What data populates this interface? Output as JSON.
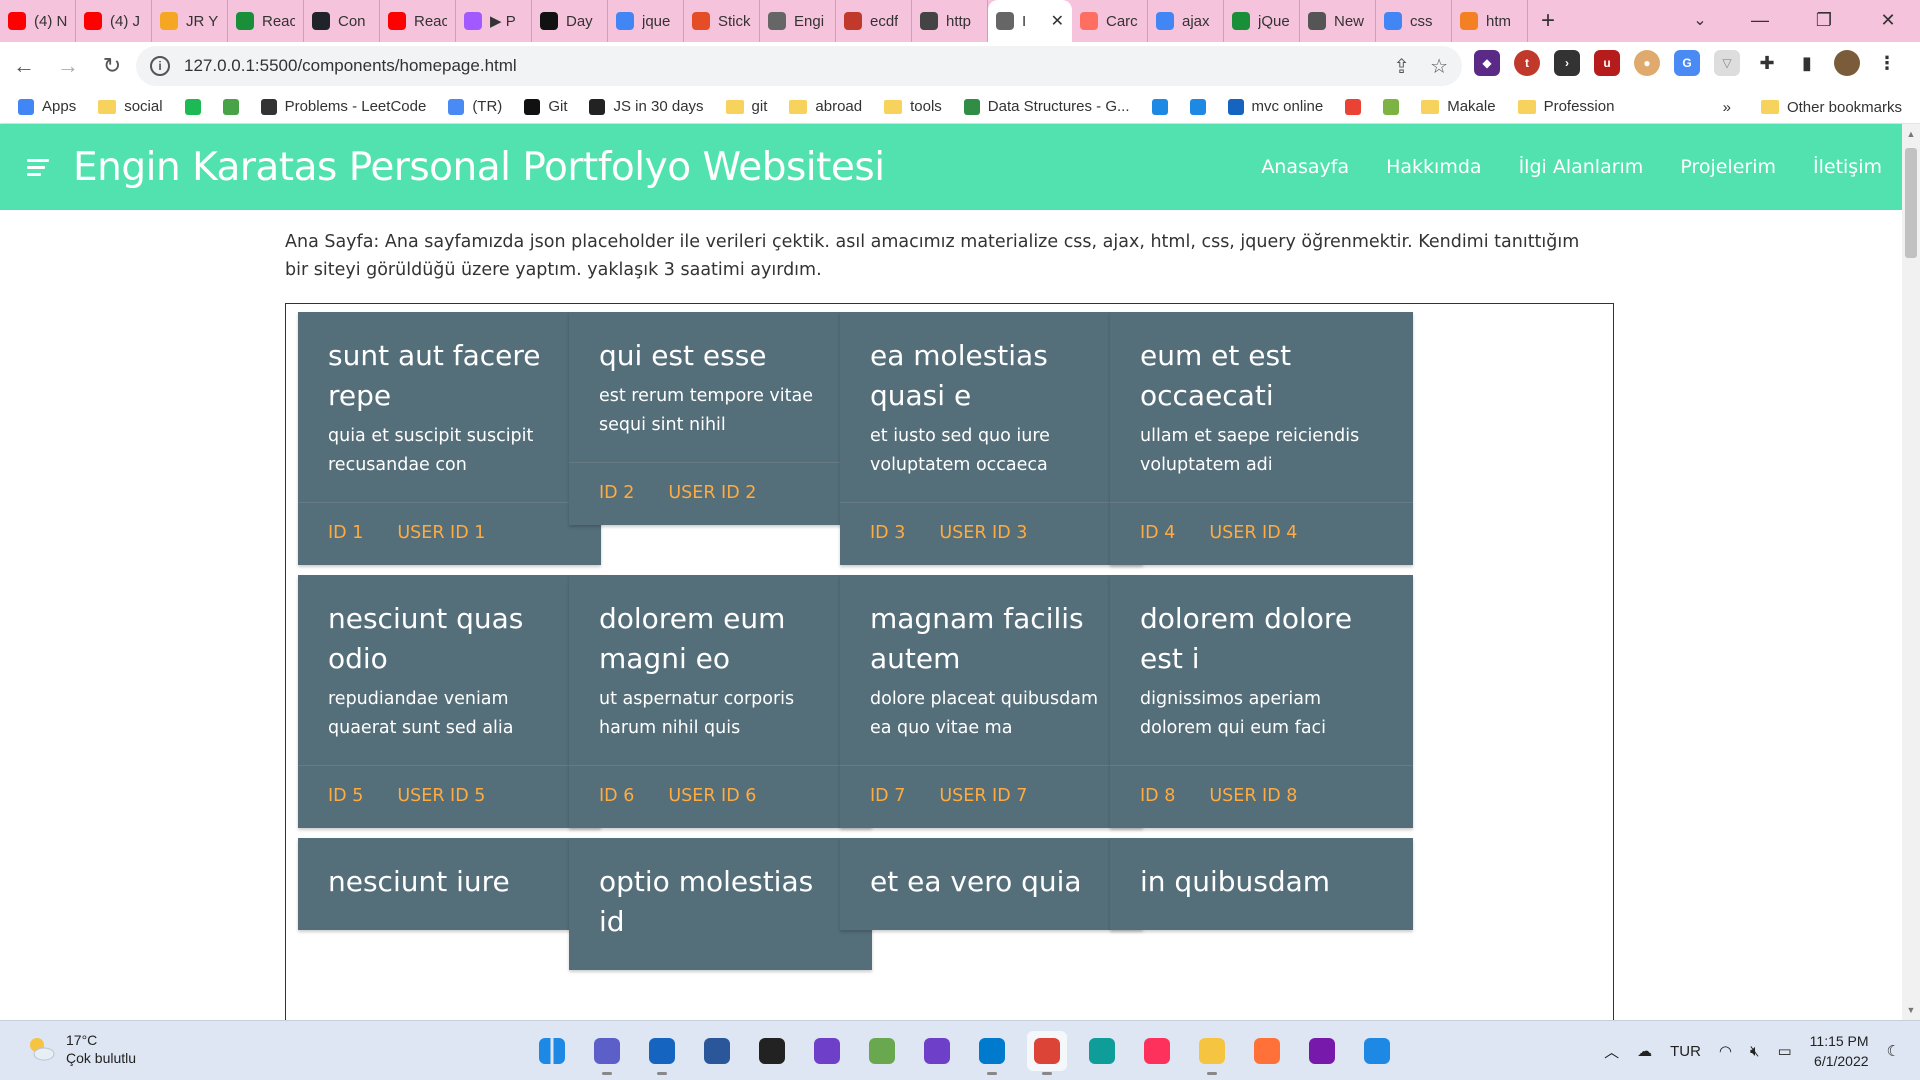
{
  "browser": {
    "tabs": [
      {
        "title": "(4) N",
        "icon": "youtube-icon",
        "color": "#ff0000"
      },
      {
        "title": "(4) J",
        "icon": "youtube-icon",
        "color": "#ff0000"
      },
      {
        "title": "JR Y",
        "icon": "k-icon",
        "color": "#f5a623"
      },
      {
        "title": "Reac",
        "icon": "w-icon",
        "color": "#1a8f3a"
      },
      {
        "title": "Con",
        "icon": "react-icon",
        "color": "#20232a"
      },
      {
        "title": "Reac",
        "icon": "youtube-icon",
        "color": "#ff0000"
      },
      {
        "title": "▶ P",
        "icon": "figma-icon",
        "color": "#a259ff"
      },
      {
        "title": "Day",
        "icon": "hashnode-icon",
        "color": "#111111"
      },
      {
        "title": "jque",
        "icon": "google-icon",
        "color": "#4285f4"
      },
      {
        "title": "Stick",
        "icon": "star-icon",
        "color": "#e44d26"
      },
      {
        "title": "Engi",
        "icon": "globe-icon",
        "color": "#666666"
      },
      {
        "title": "ecdf",
        "icon": "hf-icon",
        "color": "#c0392b"
      },
      {
        "title": "http",
        "icon": "terminal-icon",
        "color": "#444444"
      },
      {
        "title": "I",
        "icon": "globe-icon",
        "color": "#666666",
        "active": true
      },
      {
        "title": "Carc",
        "icon": "m-icon",
        "color": "#ff6f61"
      },
      {
        "title": "ajax",
        "icon": "google-icon",
        "color": "#4285f4"
      },
      {
        "title": "jQue",
        "icon": "w-icon",
        "color": "#1a8f3a"
      },
      {
        "title": "New",
        "icon": "chrome-icon",
        "color": "#555555"
      },
      {
        "title": "css",
        "icon": "google-icon",
        "color": "#4285f4"
      },
      {
        "title": "htm",
        "icon": "stackoverflow-icon",
        "color": "#f48024"
      }
    ],
    "new_tab": "+",
    "url": "127.0.0.1:5500/components/homepage.html",
    "bookmarks": [
      {
        "label": "Apps",
        "icon": "apps-grid-icon"
      },
      {
        "label": "social",
        "icon": "folder-icon"
      },
      {
        "label": "",
        "icon": "spotify-icon"
      },
      {
        "label": "",
        "icon": "leaf-icon"
      },
      {
        "label": "Problems - LeetCode",
        "icon": "leetcode-icon"
      },
      {
        "label": "(TR)",
        "icon": "translate-icon"
      },
      {
        "label": "Git",
        "icon": "github-icon"
      },
      {
        "label": "JS in 30 days",
        "icon": "js30-icon"
      },
      {
        "label": "git",
        "icon": "folder-icon"
      },
      {
        "label": "abroad",
        "icon": "folder-icon"
      },
      {
        "label": "tools",
        "icon": "folder-icon"
      },
      {
        "label": "Data Structures - G...",
        "icon": "gfg-icon"
      },
      {
        "label": "",
        "icon": "x-icon"
      },
      {
        "label": "",
        "icon": "html5-icon"
      },
      {
        "label": "mvc online",
        "icon": "mvc-icon"
      },
      {
        "label": "",
        "icon": "gmail-icon"
      },
      {
        "label": "",
        "icon": "plant-icon"
      },
      {
        "label": "Makale",
        "icon": "folder-icon"
      },
      {
        "label": "Profession",
        "icon": "folder-icon"
      }
    ],
    "bookmarks_more": "»",
    "other_bookmarks": "Other bookmarks"
  },
  "site": {
    "brand": "Engin Karatas Personal Portfolyo Websitesi",
    "nav": [
      "Anasayfa",
      "Hakkımda",
      "İlgi Alanlarım",
      "Projelerim",
      "İletişim"
    ],
    "intro": "Ana Sayfa: Ana sayfamızda json placeholder ile verileri çektik. asıl amacımız materialize css, ajax, html, css, jquery öğrenmektir. Kendimi tanıttığım bir siteyi görüldüğü üzere yaptım. yaklaşık 3 saatimi ayırdım.",
    "cards": [
      {
        "title": "sunt aut facere repe",
        "body": "quia et suscipit suscipit recusandae con",
        "id": "ID 1",
        "user": "USER ID 1"
      },
      {
        "title": "qui est esse",
        "body": "est rerum tempore vitae sequi sint nihil",
        "id": "ID 2",
        "user": "USER ID 2"
      },
      {
        "title": "ea molestias quasi e",
        "body": "et iusto sed quo iure voluptatem occaeca",
        "id": "ID 3",
        "user": "USER ID 3"
      },
      {
        "title": "eum et est occaecati",
        "body": "ullam et saepe reiciendis voluptatem adi",
        "id": "ID 4",
        "user": "USER ID 4"
      },
      {
        "title": "nesciunt quas odio",
        "body": "repudiandae veniam quaerat sunt sed alia",
        "id": "ID 5",
        "user": "USER ID 5"
      },
      {
        "title": "dolorem eum magni eo",
        "body": "ut aspernatur corporis harum nihil quis",
        "id": "ID 6",
        "user": "USER ID 6"
      },
      {
        "title": "magnam facilis autem",
        "body": "dolore placeat quibusdam ea quo vitae ma",
        "id": "ID 7",
        "user": "USER ID 7"
      },
      {
        "title": "dolorem dolore est i",
        "body": "dignissimos aperiam dolorem qui eum faci",
        "id": "ID 8",
        "user": "USER ID 8"
      },
      {
        "title": "nesciunt iure",
        "body": "",
        "id": "",
        "user": ""
      },
      {
        "title": "optio molestias id",
        "body": "",
        "id": "",
        "user": ""
      },
      {
        "title": "et ea vero quia",
        "body": "",
        "id": "",
        "user": ""
      },
      {
        "title": "in quibusdam",
        "body": "",
        "id": "",
        "user": ""
      }
    ]
  },
  "taskbar": {
    "temperature": "17°C",
    "weather": "Çok bulutlu",
    "language": "TUR",
    "time": "11:15 PM",
    "date": "6/1/2022",
    "apps": [
      "windows-start-icon",
      "teams-icon",
      "mail-icon",
      "word-app-icon",
      "media-player-icon",
      "github-desktop-icon",
      "notepad-icon",
      "github-icon",
      "vscode-icon",
      "chrome-icon",
      "edge-icon",
      "intellij-icon",
      "file-explorer-icon",
      "firefox-icon",
      "onenote-icon",
      "calendar-icon"
    ]
  },
  "colors": {
    "nav_bg": "#52e2b0",
    "card_bg": "#546e7a",
    "card_action": "#ffab40",
    "tabstrip_bg": "#f6c3dc"
  }
}
